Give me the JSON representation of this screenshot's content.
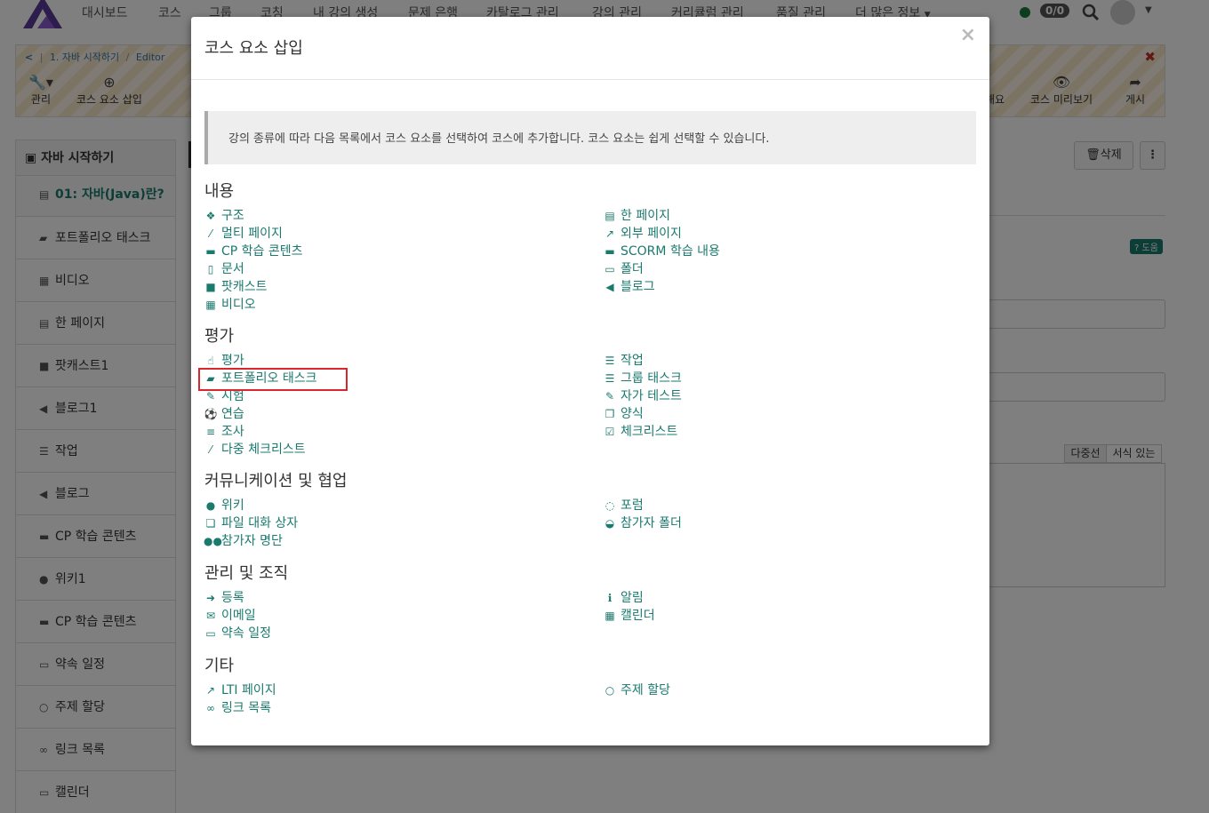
{
  "topnav": {
    "items": [
      "대시보드",
      "코스",
      "그룹",
      "코칭",
      "내 강의 생성",
      "문제 은행",
      "카탈로그 관리",
      "강의 관리",
      "커리큘럼 관리",
      "품질 관리",
      "더 많은 정보"
    ],
    "count": "0/0"
  },
  "breadcrumb": {
    "item1": "1. 자바 시작하기",
    "item2": "Editor"
  },
  "toolbar": {
    "manage": "관리",
    "insert": "코스 요소 삽입",
    "partial": "해요",
    "preview": "코스 미리보기",
    "publish": "게시"
  },
  "sidebar": {
    "title": "자바 시작하기",
    "items": [
      {
        "label": "01: 자바(Java)란?",
        "icon": "page-icon"
      },
      {
        "label": "포트폴리오 태스크",
        "icon": "briefcase-icon"
      },
      {
        "label": "비디오",
        "icon": "film-icon"
      },
      {
        "label": "한 페이지",
        "icon": "page-icon"
      },
      {
        "label": "팟캐스트1",
        "icon": "video-icon"
      },
      {
        "label": "블로그1",
        "icon": "megaphone-icon"
      },
      {
        "label": "작업",
        "icon": "tasks-icon"
      },
      {
        "label": "블로그",
        "icon": "megaphone-icon"
      },
      {
        "label": "CP 학습 콘텐츠",
        "icon": "archive-icon"
      },
      {
        "label": "위키1",
        "icon": "globe-icon"
      },
      {
        "label": "CP 학습 콘텐츠",
        "icon": "archive-icon"
      },
      {
        "label": "약속 일정",
        "icon": "calendar-icon"
      },
      {
        "label": "주제 할당",
        "icon": "circle-icon"
      },
      {
        "label": "링크 목록",
        "icon": "link-icon"
      },
      {
        "label": "캘린더",
        "icon": "calendar-icon"
      }
    ]
  },
  "editor": {
    "delete": "삭제",
    "help": "도움",
    "tab_plain": "다중선",
    "tab_rich": "서식 있는"
  },
  "modal": {
    "title": "코스 요소 삽입",
    "close": "×",
    "info": "강의 종류에 따라 다음 목록에서 코스 요소를 선택하여 코스에 추가합니다. 코스 요소는 쉽게 선택할 수 있습니다.",
    "sections": [
      {
        "title": "내용",
        "left": [
          {
            "label": "구조",
            "icon": "structure-icon"
          },
          {
            "label": "멀티 페이지",
            "icon": "wand-icon"
          },
          {
            "label": "CP 학습 콘텐츠",
            "icon": "archive-icon"
          },
          {
            "label": "문서",
            "icon": "file-icon"
          },
          {
            "label": "팟캐스트",
            "icon": "video-icon"
          },
          {
            "label": "비디오",
            "icon": "film-icon"
          }
        ],
        "right": [
          {
            "label": "한 페이지",
            "icon": "page-icon"
          },
          {
            "label": "외부 페이지",
            "icon": "external-link-icon"
          },
          {
            "label": "SCORM 학습 내용",
            "icon": "archive-icon"
          },
          {
            "label": "폴더",
            "icon": "folder-icon"
          },
          {
            "label": "블로그",
            "icon": "megaphone-icon"
          }
        ]
      },
      {
        "title": "평가",
        "left": [
          {
            "label": "평가",
            "icon": "thumbs-up-icon"
          },
          {
            "label": "포트폴리오 태스크",
            "icon": "briefcase-icon"
          },
          {
            "label": "시험",
            "icon": "edit-icon"
          },
          {
            "label": "연습",
            "icon": "soccer-icon"
          },
          {
            "label": "조사",
            "icon": "sliders-icon"
          },
          {
            "label": "다중 체크리스트",
            "icon": "wand-icon"
          }
        ],
        "right": [
          {
            "label": "작업",
            "icon": "tasks-icon"
          },
          {
            "label": "그룹 태스크",
            "icon": "tasks-icon"
          },
          {
            "label": "자가 테스트",
            "icon": "edit-icon"
          },
          {
            "label": "양식",
            "icon": "copy-icon"
          },
          {
            "label": "체크리스트",
            "icon": "checkbox-icon"
          }
        ]
      },
      {
        "title": "커뮤니케이션 및 협업",
        "left": [
          {
            "label": "위키",
            "icon": "globe-icon"
          },
          {
            "label": "파일 대화 상자",
            "icon": "files-icon"
          },
          {
            "label": "참가자 명단",
            "icon": "users-icon"
          }
        ],
        "right": [
          {
            "label": "포럼",
            "icon": "comments-icon"
          },
          {
            "label": "참가자 폴더",
            "icon": "inbox-icon"
          }
        ]
      },
      {
        "title": "관리 및 조직",
        "left": [
          {
            "label": "등록",
            "icon": "sign-in-icon"
          },
          {
            "label": "이메일",
            "icon": "envelope-icon"
          },
          {
            "label": "약속 일정",
            "icon": "calendar-icon"
          }
        ],
        "right": [
          {
            "label": "알림",
            "icon": "info-icon"
          },
          {
            "label": "캘린더",
            "icon": "calendar-grid-icon"
          }
        ]
      },
      {
        "title": "기타",
        "left": [
          {
            "label": "LTI 페이지",
            "icon": "external-link-icon"
          },
          {
            "label": "링크 목록",
            "icon": "link-icon"
          }
        ],
        "right": [
          {
            "label": "주제 할당",
            "icon": "circle-icon"
          }
        ]
      }
    ]
  },
  "colors": {
    "accent": "#1a7a6e",
    "highlight": "#d9262c"
  }
}
